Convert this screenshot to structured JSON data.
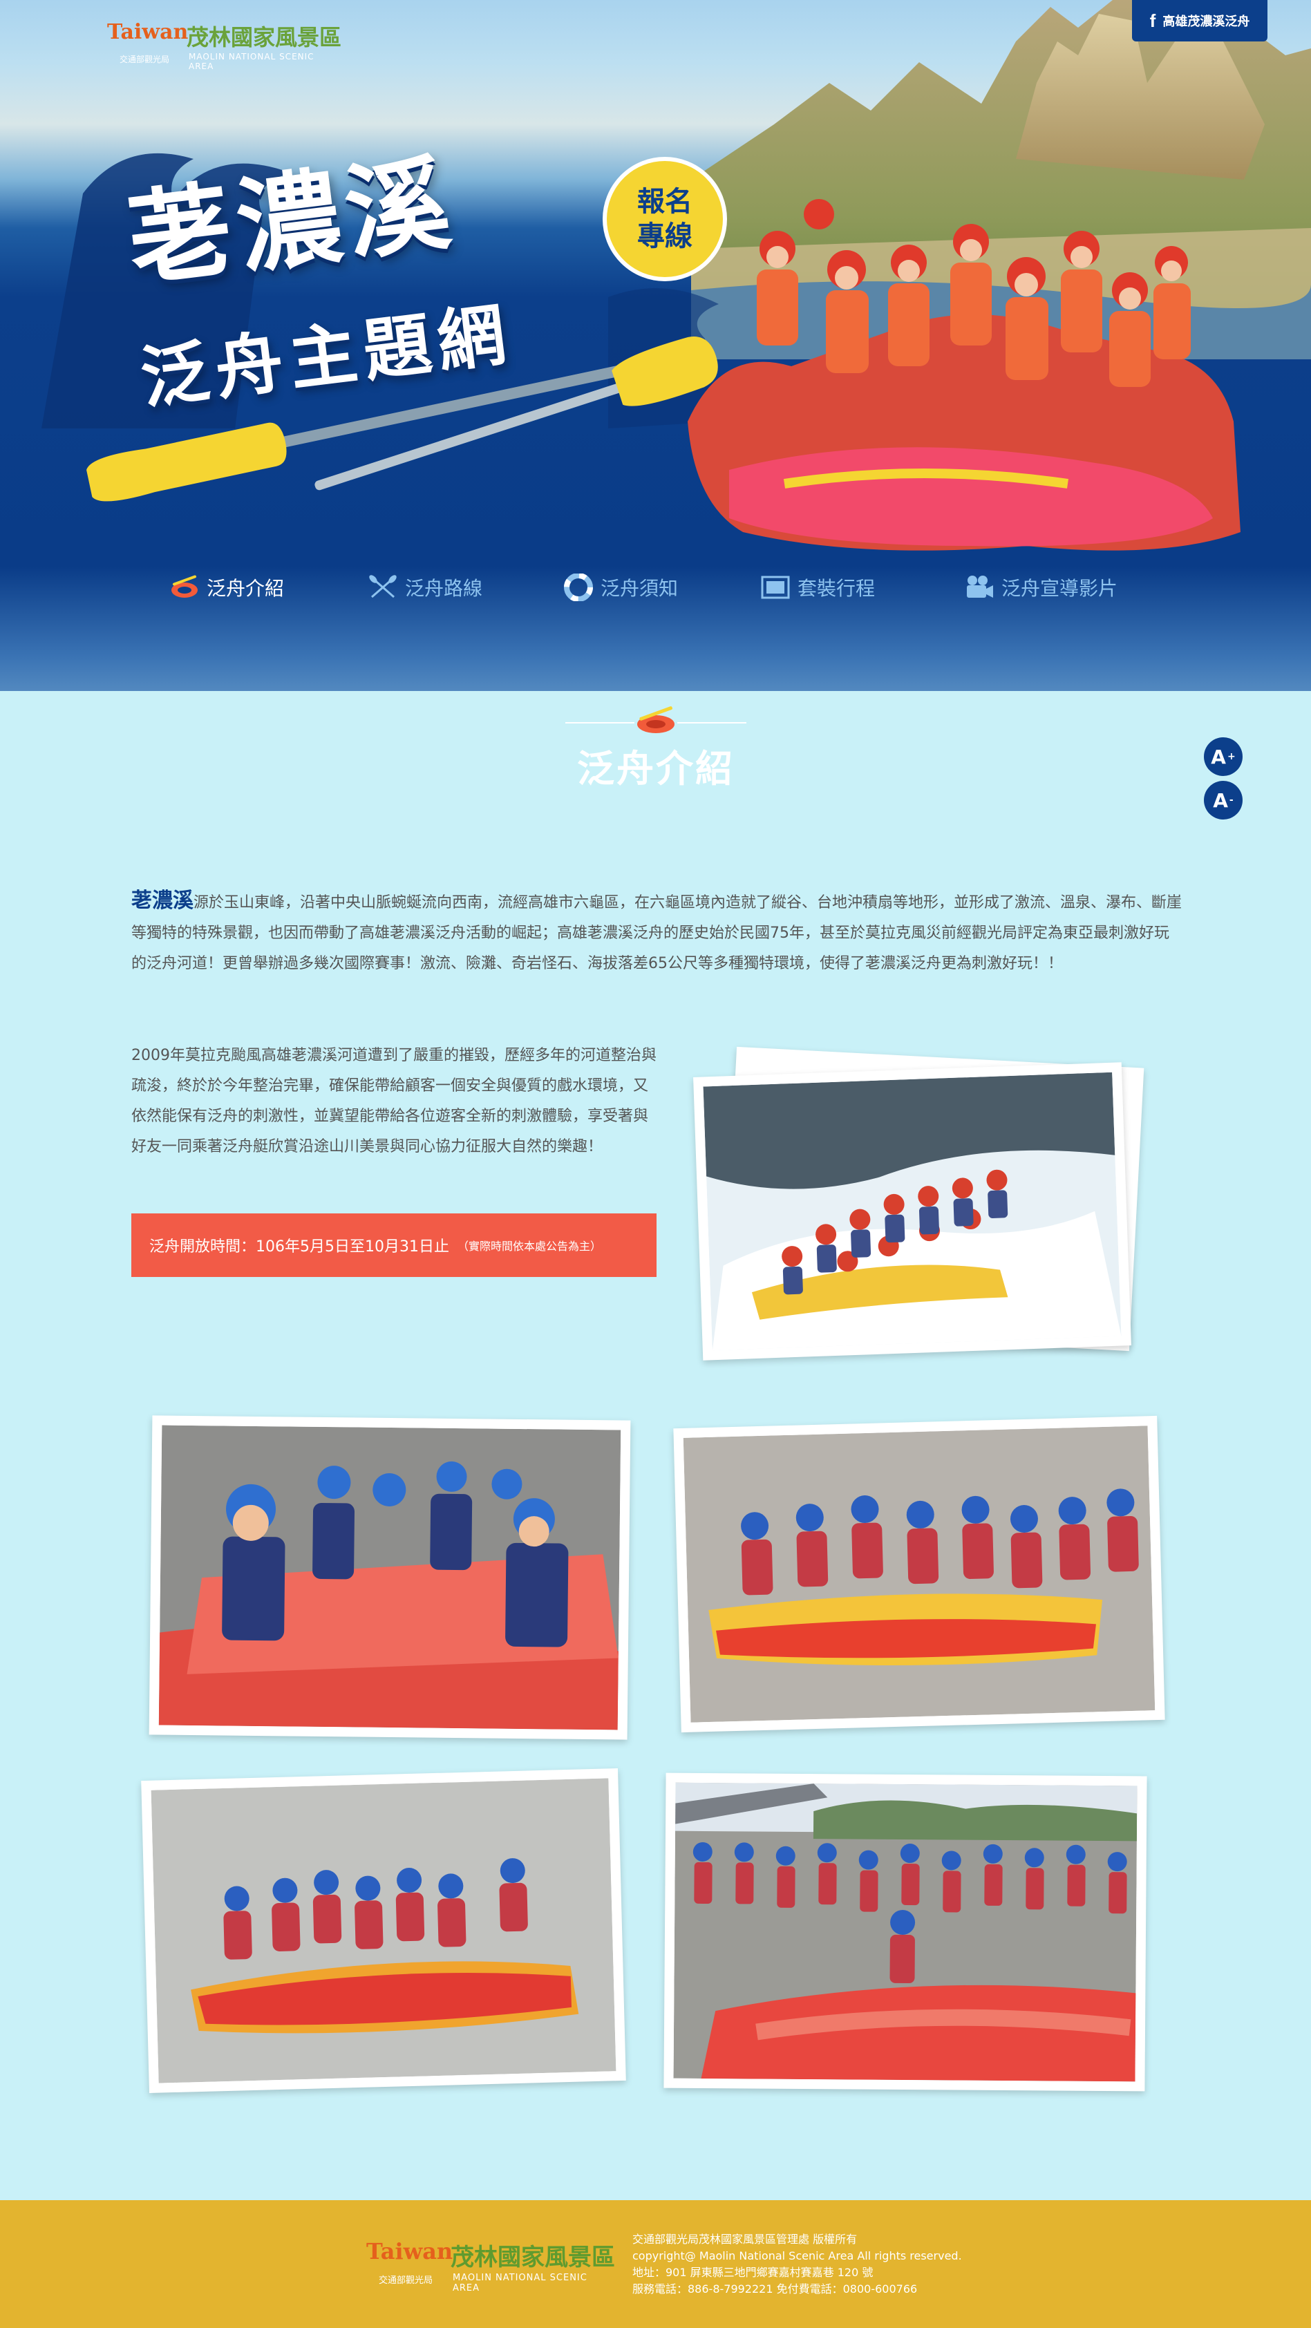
{
  "header": {
    "logo": {
      "taiwan": "Taiwan",
      "name": "茂林國家風景區",
      "sub_left": "交通部觀光局",
      "sub_right": "MAOLIN NATIONAL SCENIC AREA"
    },
    "facebook_label": "高雄茂濃溪泛舟",
    "title_line1": "荖濃溪",
    "title_line2": "泛舟主題網",
    "signup_line1": "報名",
    "signup_line2": "專線"
  },
  "nav": {
    "items": [
      {
        "label": "泛舟介紹",
        "icon": "raft-icon",
        "active": true
      },
      {
        "label": "泛舟路線",
        "icon": "paddles-icon",
        "active": false
      },
      {
        "label": "泛舟須知",
        "icon": "lifebuoy-icon",
        "active": false
      },
      {
        "label": "套裝行程",
        "icon": "photo-frame-icon",
        "active": false
      },
      {
        "label": "泛舟宣導影片",
        "icon": "video-camera-icon",
        "active": false
      }
    ]
  },
  "section": {
    "title": "泛舟介紹",
    "font_increase": "A",
    "font_decrease": "A"
  },
  "intro": {
    "lead": "荖濃溪",
    "text": "源於玉山東峰，沿著中央山脈蜿蜒流向西南，流經高雄市六龜區，在六龜區境內造就了縱谷、台地沖積扇等地形，並形成了激流、溫泉、瀑布、斷崖等獨特的特殊景觀，也因而帶動了高雄荖濃溪泛舟活動的崛起；高雄荖濃溪泛舟的歷史始於民國75年，甚至於莫拉克風災前經觀光局評定為東亞最刺激好玩的泛舟河道！更曾舉辦過多幾次國際賽事！激流、險灘、奇岩怪石、海拔落差65公尺等多種獨特環境，使得了荖濃溪泛舟更為刺激好玩！！",
    "para2": "2009年莫拉克颱風高雄荖濃溪河道遭到了嚴重的摧毀，歷經多年的河道整治與疏浚，終於於今年整治完畢，確保能帶給顧客一個安全與優質的戲水環境，又依然能保有泛舟的刺激性，並冀望能帶給各位遊客全新的刺激體驗，享受著與好友一同乘著泛舟艇欣賞沿途山川美景與同心協力征服大自然的樂趣！",
    "notice": "泛舟開放時間：106年5月5日至10月31日止",
    "notice_small": "（實際時間依本處公告為主）"
  },
  "footer": {
    "logo": {
      "taiwan": "Taiwan",
      "name": "茂林國家風景區",
      "sub_left": "交通部觀光局",
      "sub_right": "MAOLIN NATIONAL SCENIC AREA"
    },
    "line1": "交通部觀光局茂林國家風景區管理處 版權所有",
    "line2": "copyright@ Maolin National Scenic Area All rights reserved.",
    "line3": "地址：901 屏東縣三地門鄉賽嘉村賽嘉巷 120 號",
    "line4": "服務電話：886-8-7992221 免付費電話：0800-600766"
  },
  "colors": {
    "navy": "#0c3f8b",
    "sky": "#c9f1f8",
    "notice_red": "#f25b47",
    "footer_gold": "#e3b42f",
    "signup_yellow": "#f5d532"
  }
}
